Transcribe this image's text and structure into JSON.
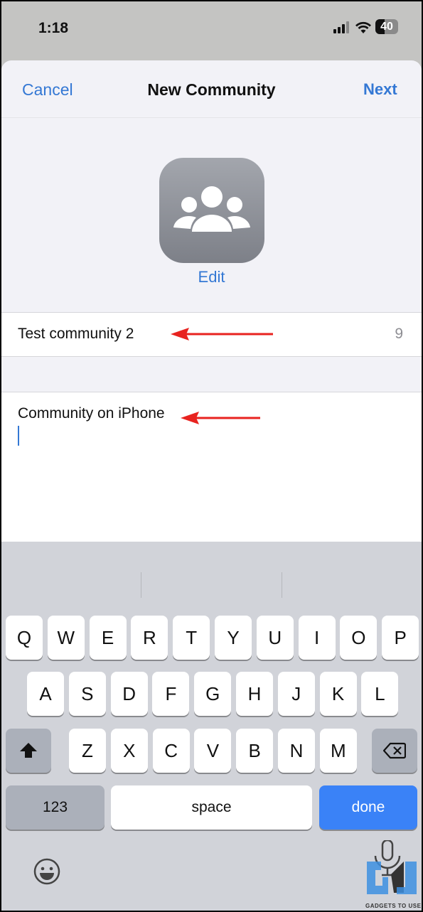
{
  "status": {
    "time": "1:18",
    "battery": "40"
  },
  "nav": {
    "cancel": "Cancel",
    "title": "New Community",
    "next": "Next"
  },
  "avatar": {
    "icon": "people-group-icon",
    "edit": "Edit"
  },
  "name_field": {
    "value": "Test community 2",
    "counter": "9"
  },
  "description_field": {
    "value": "Community on iPhone"
  },
  "keyboard": {
    "row1": [
      "Q",
      "W",
      "E",
      "R",
      "T",
      "Y",
      "U",
      "I",
      "O",
      "P"
    ],
    "row2": [
      "A",
      "S",
      "D",
      "F",
      "G",
      "H",
      "J",
      "K",
      "L"
    ],
    "row3": [
      "Z",
      "X",
      "C",
      "V",
      "B",
      "N",
      "M"
    ],
    "numbers": "123",
    "space": "space",
    "done": "done"
  },
  "watermark": "GADGETS TO USE",
  "colors": {
    "accent": "#3478d4",
    "arrow": "#e8231f",
    "done_key": "#3a82f7"
  }
}
